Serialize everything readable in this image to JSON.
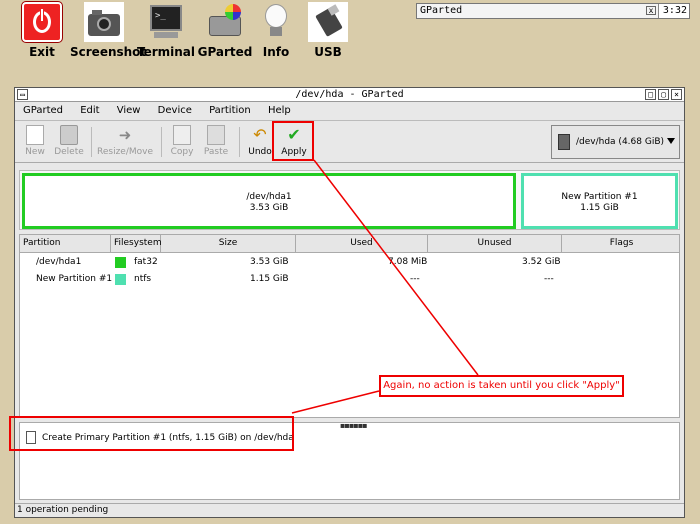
{
  "desktop": {
    "launchers": [
      {
        "label": "Exit",
        "icon": "power-icon"
      },
      {
        "label": "Screenshot",
        "icon": "camera-icon"
      },
      {
        "label": "Terminal",
        "icon": "terminal-icon"
      },
      {
        "label": "GParted",
        "icon": "gparted-icon"
      },
      {
        "label": "Info",
        "icon": "lightbulb-icon"
      },
      {
        "label": "USB",
        "icon": "usb-icon"
      }
    ]
  },
  "taskbar": {
    "active_task": "GParted",
    "close_glyph": "x",
    "clock": "3:32"
  },
  "window": {
    "title": "/dev/hda - GParted",
    "controls": [
      "□",
      "▢",
      "×"
    ],
    "left_control": "▭"
  },
  "menu": [
    "GParted",
    "Edit",
    "View",
    "Device",
    "Partition",
    "Help"
  ],
  "toolbar": {
    "new": "New",
    "delete": "Delete",
    "resize": "Resize/Move",
    "copy": "Copy",
    "paste": "Paste",
    "undo": "Undo",
    "apply": "Apply",
    "device": "/dev/hda   (4.68 GiB)"
  },
  "visual": {
    "p1_name": "/dev/hda1",
    "p1_size": "3.53 GiB",
    "p2_name": "New Partition #1",
    "p2_size": "1.15 GiB"
  },
  "table": {
    "headers": [
      "Partition",
      "Filesystem",
      "Size",
      "Used",
      "Unused",
      "Flags"
    ],
    "rows": [
      {
        "partition": "/dev/hda1",
        "fs": "fat32",
        "size": "3.53 GiB",
        "used": "7.08 MiB",
        "unused": "3.52 GiB",
        "flags": "",
        "color": "#22cc22"
      },
      {
        "partition": "New Partition #1",
        "fs": "ntfs",
        "size": "1.15 GiB",
        "used": "---",
        "unused": "---",
        "flags": "",
        "color": "#4fe0b0"
      }
    ]
  },
  "operations": {
    "items": [
      "Create Primary Partition #1 (ntfs, 1.15 GiB) on /dev/hda"
    ],
    "grip": "▪▪▪▪▪▪"
  },
  "status": "1 operation pending",
  "annotation": "Again, no action is taken until you click \"Apply\"",
  "colors": {
    "fat32": "#22cc22",
    "ntfs": "#4fe0b0",
    "annotation": "#e00000"
  }
}
